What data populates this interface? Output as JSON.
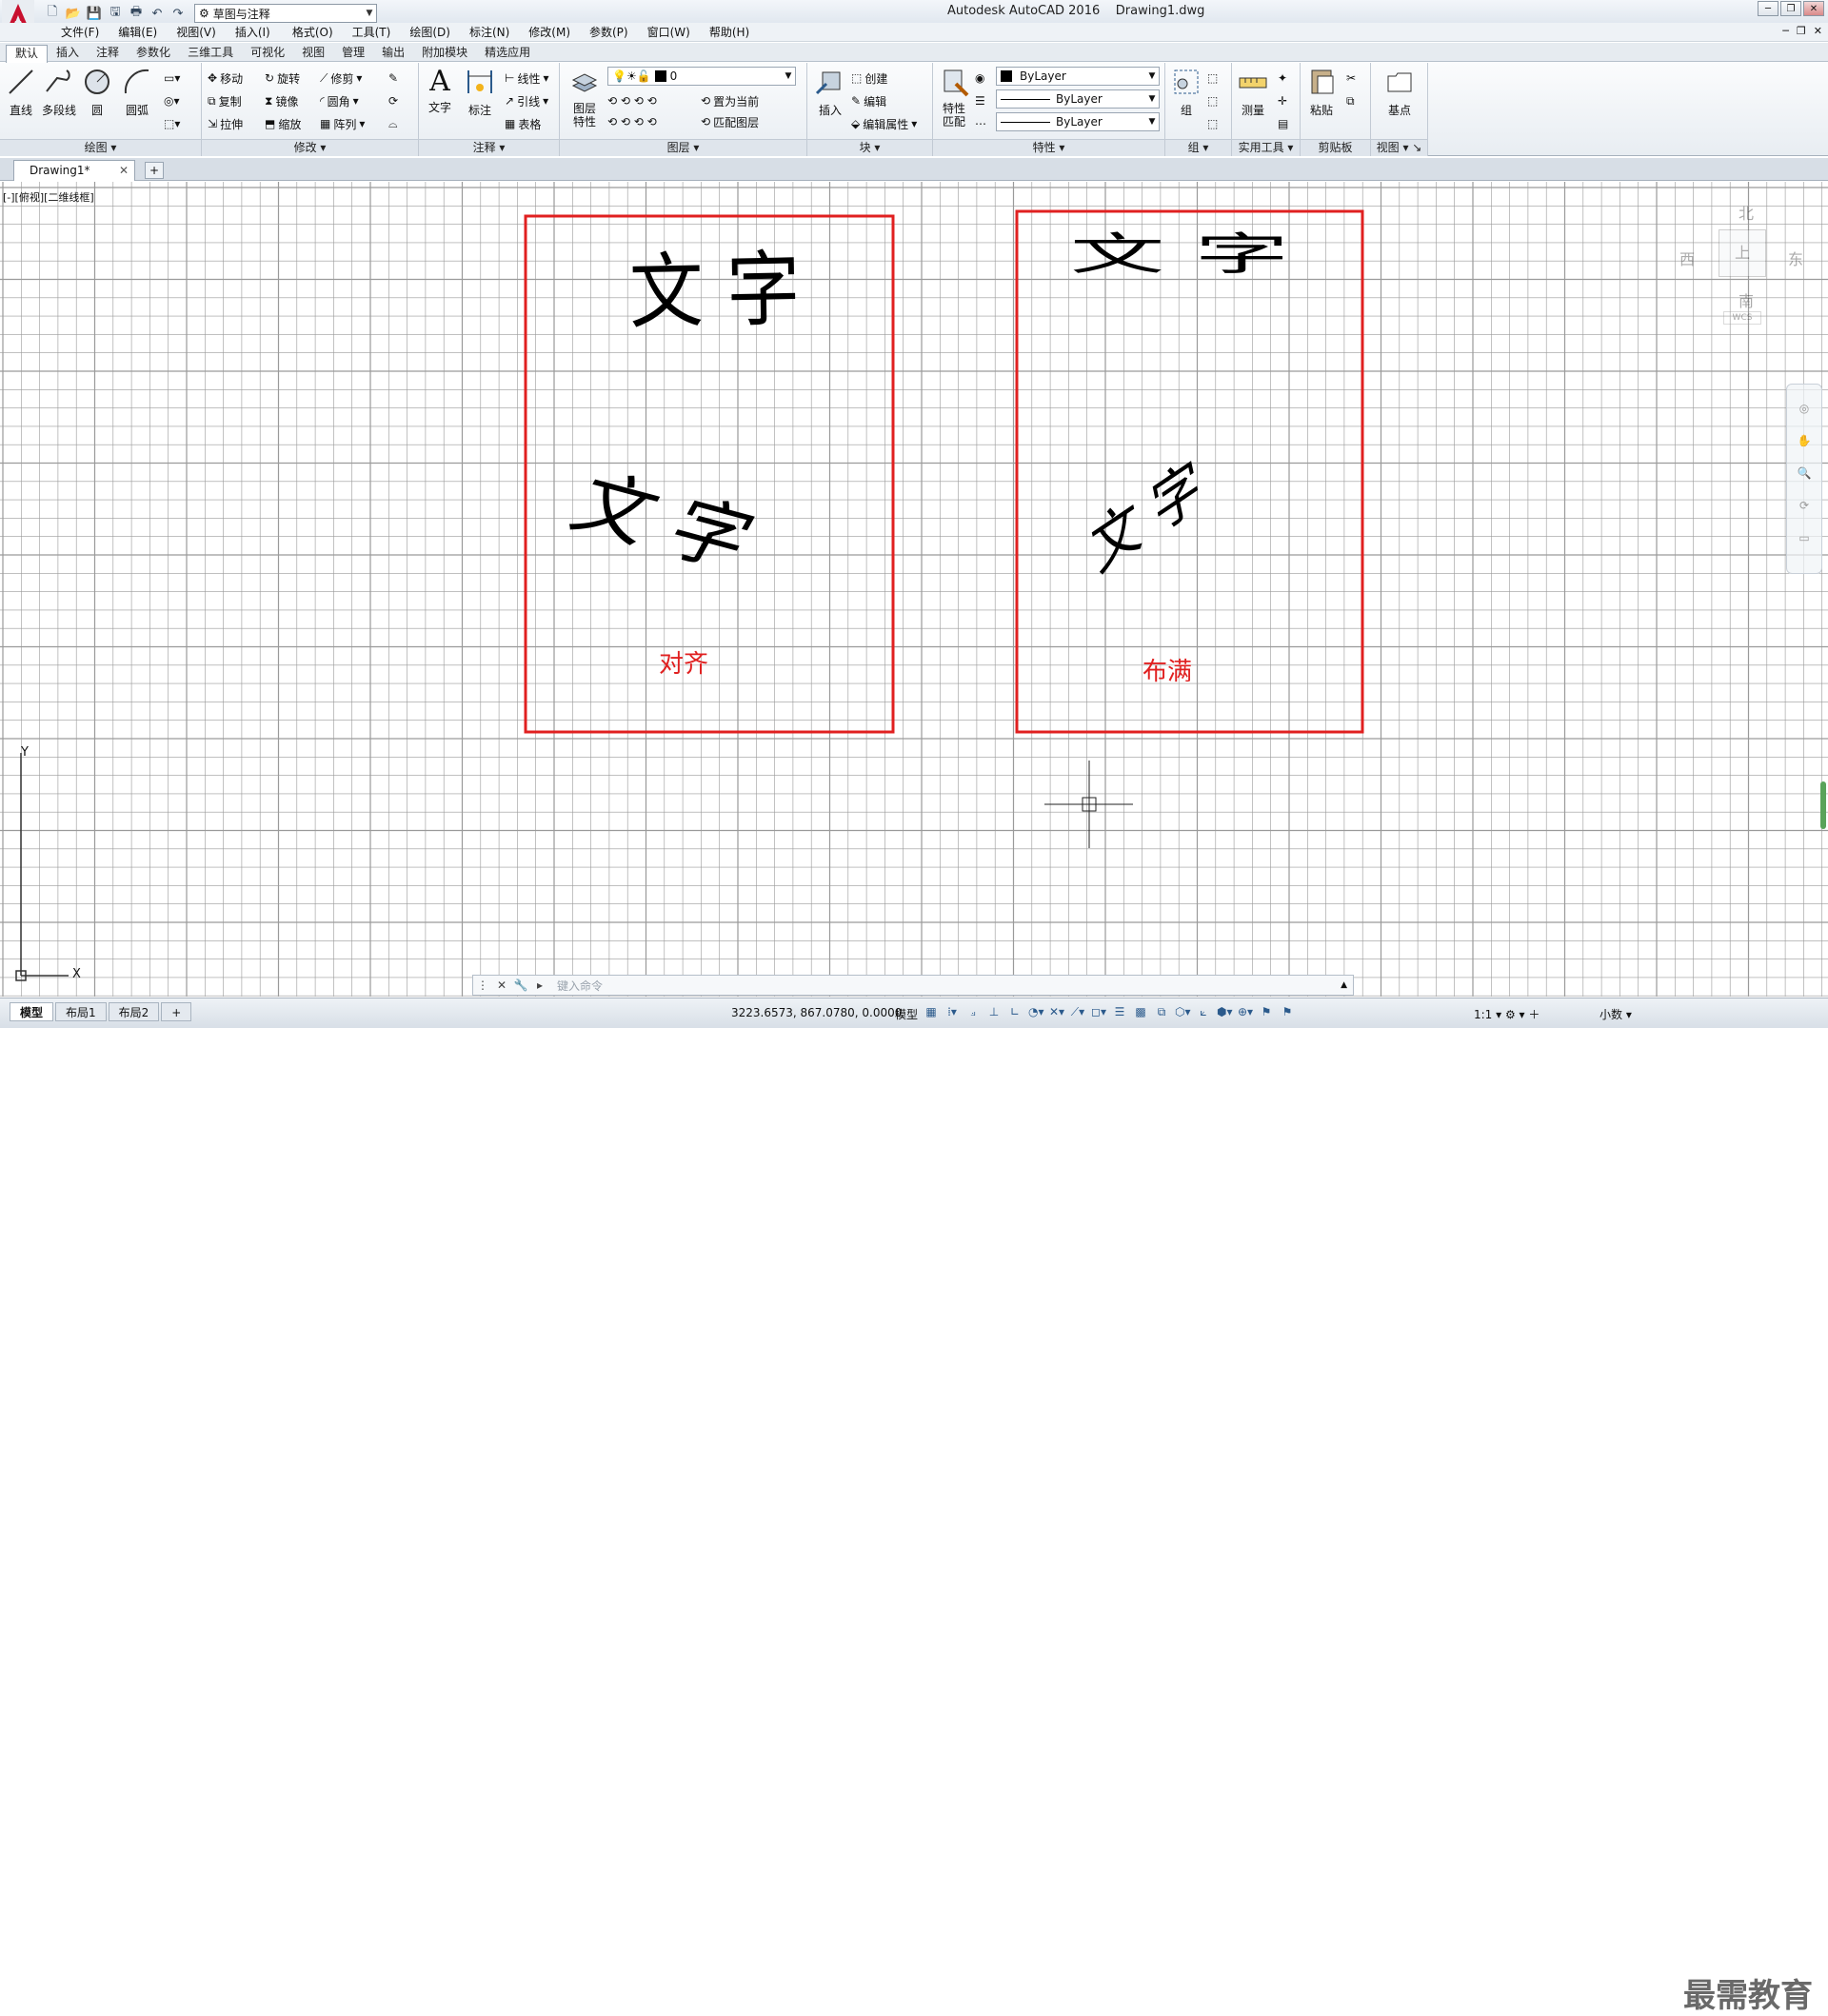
{
  "window": {
    "app_title": "Autodesk AutoCAD 2016",
    "document_title": "Drawing1.dwg",
    "workspace": "草图与注释"
  },
  "menu": [
    "文件(F)",
    "编辑(E)",
    "视图(V)",
    "插入(I)",
    "格式(O)",
    "工具(T)",
    "绘图(D)",
    "标注(N)",
    "修改(M)",
    "参数(P)",
    "窗口(W)",
    "帮助(H)"
  ],
  "ribbon_tabs": [
    "默认",
    "插入",
    "注释",
    "参数化",
    "三维工具",
    "可视化",
    "视图",
    "管理",
    "输出",
    "附加模块",
    "精选应用"
  ],
  "ribbon": {
    "draw": {
      "title": "绘图",
      "line": "直线",
      "polyline": "多段线",
      "circle": "圆",
      "arc": "圆弧"
    },
    "modify": {
      "title": "修改",
      "move": "移动",
      "rotate": "旋转",
      "trim": "修剪",
      "copy": "复制",
      "mirror": "镜像",
      "fillet": "圆角",
      "stretch": "拉伸",
      "scale": "缩放",
      "array": "阵列"
    },
    "annotation": {
      "title": "注释",
      "text": "文字",
      "dimension": "标注",
      "linear": "线性",
      "leader": "引线",
      "table": "表格"
    },
    "layers": {
      "title": "图层",
      "layer_props": "图层\n特性",
      "layer_props_a": "图层",
      "layer_props_b": "特性",
      "current_layer": "0",
      "set_current": "置为当前",
      "match_layer": "匹配图层"
    },
    "block": {
      "title": "块",
      "insert": "插入",
      "create": "创建",
      "edit": "编辑",
      "edit_attr": "编辑属性"
    },
    "properties": {
      "title": "特性",
      "match_a": "特性",
      "match_b": "匹配",
      "color": "ByLayer",
      "linetype": "ByLayer",
      "lineweight": "ByLayer"
    },
    "groups": {
      "title": "组",
      "group": "组"
    },
    "utilities": {
      "title": "实用工具",
      "measure": "测量"
    },
    "clipboard": {
      "title": "剪贴板",
      "paste": "粘贴"
    },
    "view": {
      "title": "视图",
      "base": "基点"
    }
  },
  "file_tab": {
    "name": "Drawing1*"
  },
  "viewport_label": "[-][俯视][二维线框]",
  "viewcube": {
    "north": "北",
    "south": "南",
    "east": "东",
    "west": "西",
    "top": "上",
    "wcs": "WCS"
  },
  "drawing": {
    "left_box": {
      "text_top": "文 字",
      "text_bottom": "文 字",
      "label": "对齐"
    },
    "right_box": {
      "text_top": "文 字",
      "text_bottom": "文 字",
      "label": "布满"
    }
  },
  "ucs": {
    "x": "X",
    "y": "Y"
  },
  "command_line": {
    "placeholder": "键入命令"
  },
  "layout_tabs": [
    "模型",
    "布局1",
    "布局2"
  ],
  "status": {
    "coordinates": "3223.6573, 867.0780, 0.0000",
    "model": "模型",
    "scale": "1:1",
    "units": "小数"
  },
  "watermark": "最需教育",
  "colors": {
    "red_box": "#e02020",
    "grid": "#9a9a9a",
    "accent": "#c8102e"
  }
}
